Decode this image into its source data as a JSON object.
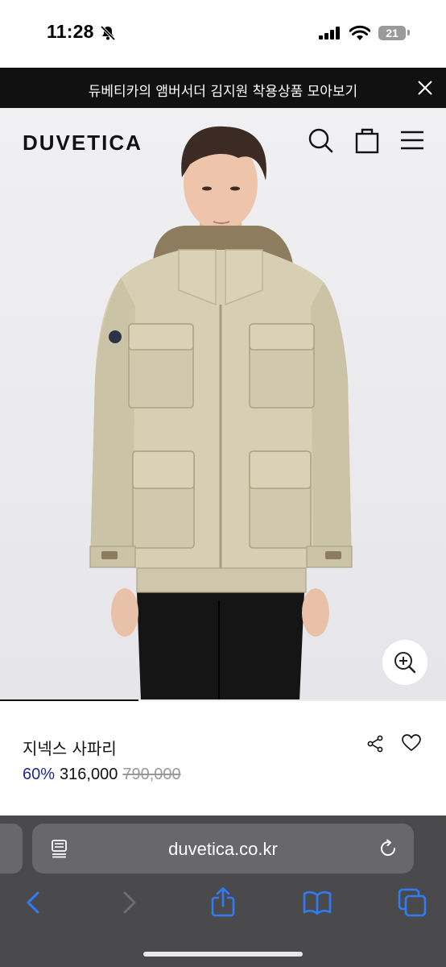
{
  "status_bar": {
    "time": "11:28",
    "battery": "21"
  },
  "banner": {
    "text": "듀베티카의 앰버서더 김지원 착용상품 모아보기"
  },
  "header": {
    "logo": "DUVETICA"
  },
  "product": {
    "name": "지넥스 사파리",
    "discount": "60%",
    "sale_price": "316,000",
    "original_price": "790,000",
    "image_progress": 0.31
  },
  "browser": {
    "url": "duvetica.co.kr"
  },
  "colors": {
    "accent_discount": "#1b2a8c",
    "banner_bg": "#111111",
    "jacket": "#d6cfb4",
    "toolbar_icon": "#2f7cf6"
  },
  "icons": [
    "bell-slash-icon",
    "signal-icon",
    "wifi-icon",
    "close-icon",
    "search-icon",
    "shopping-bag-icon",
    "menu-icon",
    "zoom-in-icon",
    "share-icon",
    "heart-icon",
    "reader-icon",
    "reload-icon",
    "back-icon",
    "forward-icon",
    "share-upload-icon",
    "bookmarks-icon",
    "tabs-icon"
  ]
}
